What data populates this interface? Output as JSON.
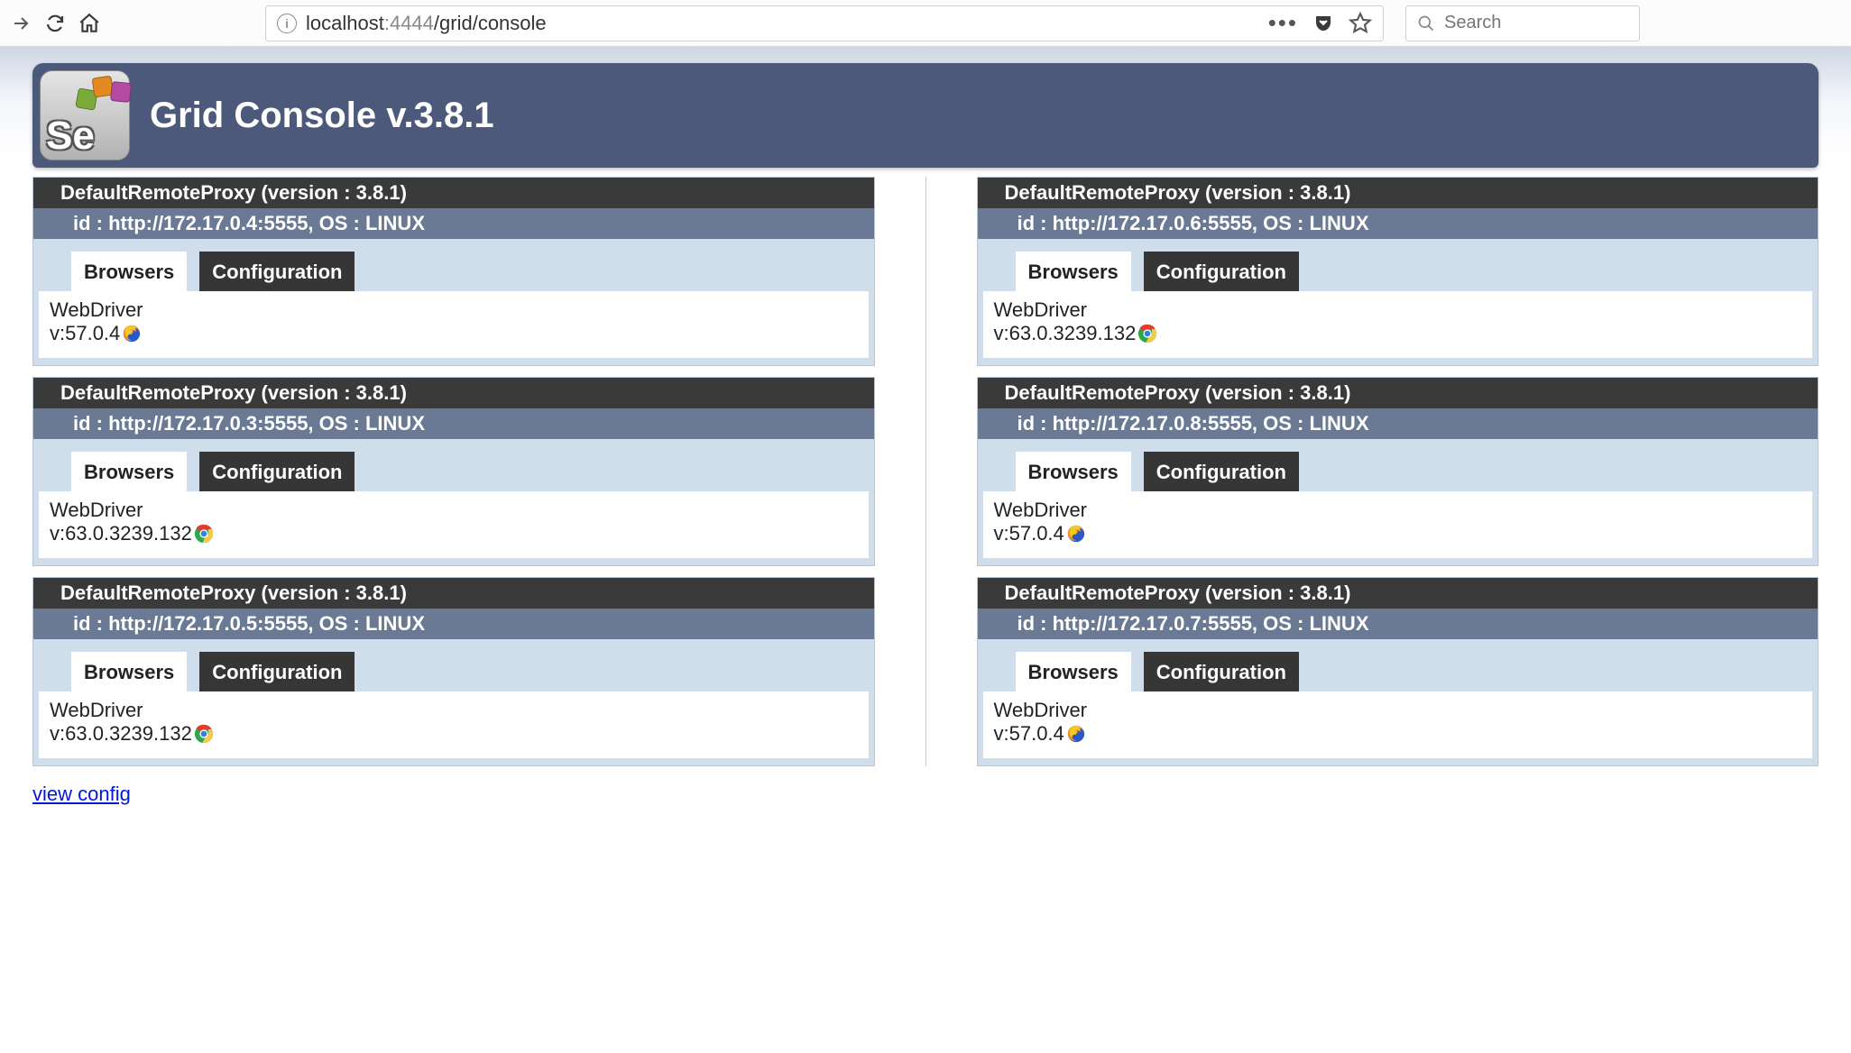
{
  "browser": {
    "url_host": "localhost",
    "url_port": ":4444",
    "url_path": "/grid/console",
    "search_placeholder": "Search"
  },
  "header": {
    "logo_text": "Se",
    "title": "Grid Console v.3.8.1"
  },
  "tabs": {
    "browsers": "Browsers",
    "configuration": "Configuration"
  },
  "webdriver_label": "WebDriver",
  "version_prefix": "v:",
  "view_config": "view config",
  "left_nodes": [
    {
      "title": "DefaultRemoteProxy (version : 3.8.1)",
      "sub": "id : http://172.17.0.4:5555, OS : LINUX",
      "version": "57.0.4",
      "browser": "firefox"
    },
    {
      "title": "DefaultRemoteProxy (version : 3.8.1)",
      "sub": "id : http://172.17.0.3:5555, OS : LINUX",
      "version": "63.0.3239.132",
      "browser": "chrome"
    },
    {
      "title": "DefaultRemoteProxy (version : 3.8.1)",
      "sub": "id : http://172.17.0.5:5555, OS : LINUX",
      "version": "63.0.3239.132",
      "browser": "chrome"
    }
  ],
  "right_nodes": [
    {
      "title": "DefaultRemoteProxy (version : 3.8.1)",
      "sub": "id : http://172.17.0.6:5555, OS : LINUX",
      "version": "63.0.3239.132",
      "browser": "chrome"
    },
    {
      "title": "DefaultRemoteProxy (version : 3.8.1)",
      "sub": "id : http://172.17.0.8:5555, OS : LINUX",
      "version": "57.0.4",
      "browser": "firefox"
    },
    {
      "title": "DefaultRemoteProxy (version : 3.8.1)",
      "sub": "id : http://172.17.0.7:5555, OS : LINUX",
      "version": "57.0.4",
      "browser": "firefox"
    }
  ]
}
